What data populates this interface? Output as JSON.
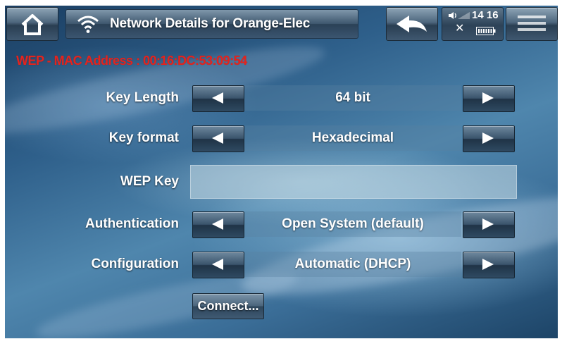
{
  "header": {
    "title": "Network Details for Orange-Elec",
    "home_icon": "home-icon",
    "wifi_icon": "wifi-icon",
    "back_icon": "back-arrow-icon",
    "menu_icon": "menu-icon"
  },
  "status": {
    "time": "14 16",
    "volume_icon": "volume-icon",
    "bluetooth_icon": "bluetooth-icon",
    "battery_icon": "battery-icon"
  },
  "mac_line": "WEP - MAC Address : 00:16:DC:53:09:54",
  "rows": [
    {
      "label": "Key Length",
      "value": "64 bit"
    },
    {
      "label": "Key format",
      "value": "Hexadecimal"
    },
    {
      "label": "WEP Key",
      "value": ""
    },
    {
      "label": "Authentication",
      "value": "Open System (default)"
    },
    {
      "label": "Configuration",
      "value": "Automatic (DHCP)"
    }
  ],
  "connect_label": "Connect...",
  "colors": {
    "mac_text": "#e3241e",
    "text": "#ffffff"
  }
}
